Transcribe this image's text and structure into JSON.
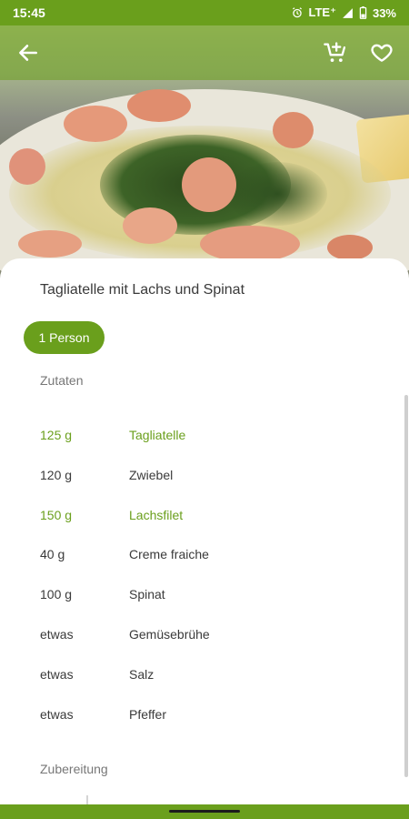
{
  "status_bar": {
    "time": "15:45",
    "network": "LTE⁺",
    "battery": "33%"
  },
  "app_bar": {
    "back_icon": "arrow-left-icon",
    "cart_icon": "add-to-cart-icon",
    "favorite_icon": "heart-outline-icon"
  },
  "recipe": {
    "title": "Tagliatelle mit Lachs und Spinat",
    "servings_chip": "1 Person",
    "ingredients_label": "Zutaten",
    "preparation_label": "Zubereitung",
    "ingredients": [
      {
        "amount": "125 g",
        "name": "Tagliatelle",
        "highlight": true
      },
      {
        "amount": "120 g",
        "name": "Zwiebel",
        "highlight": false
      },
      {
        "amount": "150 g",
        "name": "Lachsfilet",
        "highlight": true
      },
      {
        "amount": "40 g",
        "name": "Creme fraiche",
        "highlight": false
      },
      {
        "amount": "100 g",
        "name": "Spinat",
        "highlight": false
      },
      {
        "amount": "etwas",
        "name": "Gemüsebrühe",
        "highlight": false
      },
      {
        "amount": "etwas",
        "name": "Salz",
        "highlight": false
      },
      {
        "amount": "etwas",
        "name": "Pfeffer",
        "highlight": false
      }
    ]
  },
  "colors": {
    "brand_green": "#6a9f1c",
    "text_dark": "#3a3a3a",
    "text_muted": "#777777"
  }
}
